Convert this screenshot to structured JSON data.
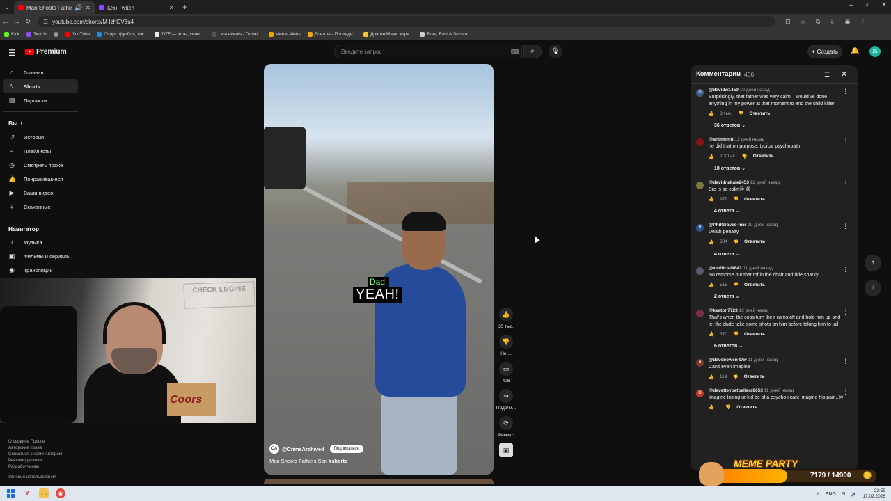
{
  "browser": {
    "tabs": [
      {
        "label": "Man Shoots Fathers Son #",
        "active": true
      },
      {
        "label": "(26) Twitch",
        "active": false
      }
    ],
    "url": "youtube.com/shorts/M-Izhl9V6u4",
    "bookmarks": [
      "Kick",
      "Twitch",
      "YouTube",
      "Спорт: футбол, хок...",
      "DTF — игры, кино,...",
      "Last events - Donat...",
      "Meme Alerts",
      "Донаты - Последн...",
      "Драгон Мани: игра...",
      "Free, Fast & Secure..."
    ]
  },
  "header": {
    "logo": "Premium",
    "search_placeholder": "Введите запрос",
    "create_label": "Создать",
    "avatar_letter": "Ж"
  },
  "sidebar": {
    "main": [
      {
        "label": "Главная",
        "icon": "home-icon"
      },
      {
        "label": "Shorts",
        "icon": "shorts-icon"
      },
      {
        "label": "Подписки",
        "icon": "subscriptions-icon"
      }
    ],
    "you_header": "Вы",
    "you": [
      {
        "label": "История",
        "icon": "history-icon"
      },
      {
        "label": "Плейлисты",
        "icon": "playlist-icon"
      },
      {
        "label": "Смотреть позже",
        "icon": "clock-icon"
      },
      {
        "label": "Понравившиеся",
        "icon": "like-icon"
      },
      {
        "label": "Ваши видео",
        "icon": "video-icon"
      },
      {
        "label": "Скачанные",
        "icon": "download-icon"
      }
    ],
    "nav_header": "Навигатор",
    "nav": [
      {
        "label": "Музыка",
        "icon": "music-icon"
      },
      {
        "label": "Фильмы и сериалы",
        "icon": "film-icon"
      },
      {
        "label": "Трансляции",
        "icon": "live-icon"
      }
    ],
    "footer": [
      "О сервисе  Прессе",
      "Авторские права",
      "Связаться с нами  Авторам",
      "Рекламодателям",
      "Разработчикам",
      "",
      "Условия использования"
    ]
  },
  "webcam": {
    "sign_text": "CHECK ENGINE",
    "box_text": "Coors"
  },
  "video": {
    "caption_speaker": "Dad:",
    "caption_line": "YEAH!",
    "channel": "@CrimeArchived",
    "subscribe_label": "Подписаться",
    "title": "Man Shoots Fathers Son",
    "hashtag": "#shorts"
  },
  "actions": [
    {
      "name": "like",
      "icon": "like-icon",
      "count": "35 тыс."
    },
    {
      "name": "dislike",
      "icon": "dislike-icon",
      "count": "Не ..."
    },
    {
      "name": "comments",
      "icon": "comment-icon",
      "count": "406"
    },
    {
      "name": "share",
      "icon": "share-icon",
      "count": "Подели..."
    },
    {
      "name": "remix",
      "icon": "remix-icon",
      "count": "Ремикс"
    }
  ],
  "comments_panel": {
    "title": "Комментарии",
    "count": "406",
    "reply_label": "Ответить",
    "items": [
      {
        "author": "@davidw1450",
        "time": "10 дней назад",
        "text": "Surprisingly, that father was very calm. I would've done anything in my power at that moment to end the child killer",
        "likes": "3 тыс.",
        "replies": "36 ответов",
        "avatar_color": "#3b5e8c",
        "avatar_letter": "D"
      },
      {
        "author": "@ahtmtmm",
        "time": "13 дней назад",
        "text": "he did that on purpose, typical psychopath",
        "likes": "2,3 тыс.",
        "replies": "18 ответов",
        "avatar_color": "#8a1414",
        "avatar_letter": ""
      },
      {
        "author": "@davidnakale2453",
        "time": "11 дней назад",
        "text": "Bro is so calm😢 😡",
        "likes": "979",
        "replies": "4 ответа",
        "avatar_color": "#7a7a3a",
        "avatar_letter": ""
      },
      {
        "author": "@PhilGraves-m5r",
        "time": "10 дней назад",
        "text": "Death penalty",
        "likes": "304",
        "replies": "4 ответа",
        "avatar_color": "#2f4f8a",
        "avatar_letter": "P"
      },
      {
        "author": "@xtofficial9643",
        "time": "11 дней назад",
        "text": "No remorse put that mf in the chair and  ride sparky",
        "likes": "515",
        "replies": "2 ответа",
        "avatar_color": "#5b5b6b",
        "avatar_letter": ""
      },
      {
        "author": "@keaton7723",
        "time": "13 дней назад",
        "text": "That's when the cops turn their cams off and hold him up and let the dude take some shots on him before taking him to jail",
        "likes": "370",
        "replies": "6 ответов",
        "avatar_color": "#7a2e4a",
        "avatar_letter": ""
      },
      {
        "author": "@davebowen-t7w",
        "time": "11 дней назад",
        "text": "Can't even imagine",
        "likes": "119",
        "replies": "",
        "avatar_color": "#7a3a2a",
        "avatar_letter": "d"
      },
      {
        "author": "@devettevoetballers8653",
        "time": "11 дней назад",
        "text": "Imagine losing ur kid bc of a psycho i cant imagine his pain..😢",
        "likes": "",
        "replies": "",
        "avatar_color": "#c0392b",
        "avatar_letter": "D"
      }
    ]
  },
  "meme_party": {
    "title": "MEME PARTY",
    "progress_text": "7179 / 14900",
    "progress_fraction": 0.48
  },
  "taskbar": {
    "lang": "ENG",
    "time": "23:59",
    "date": "17.02.2026"
  }
}
